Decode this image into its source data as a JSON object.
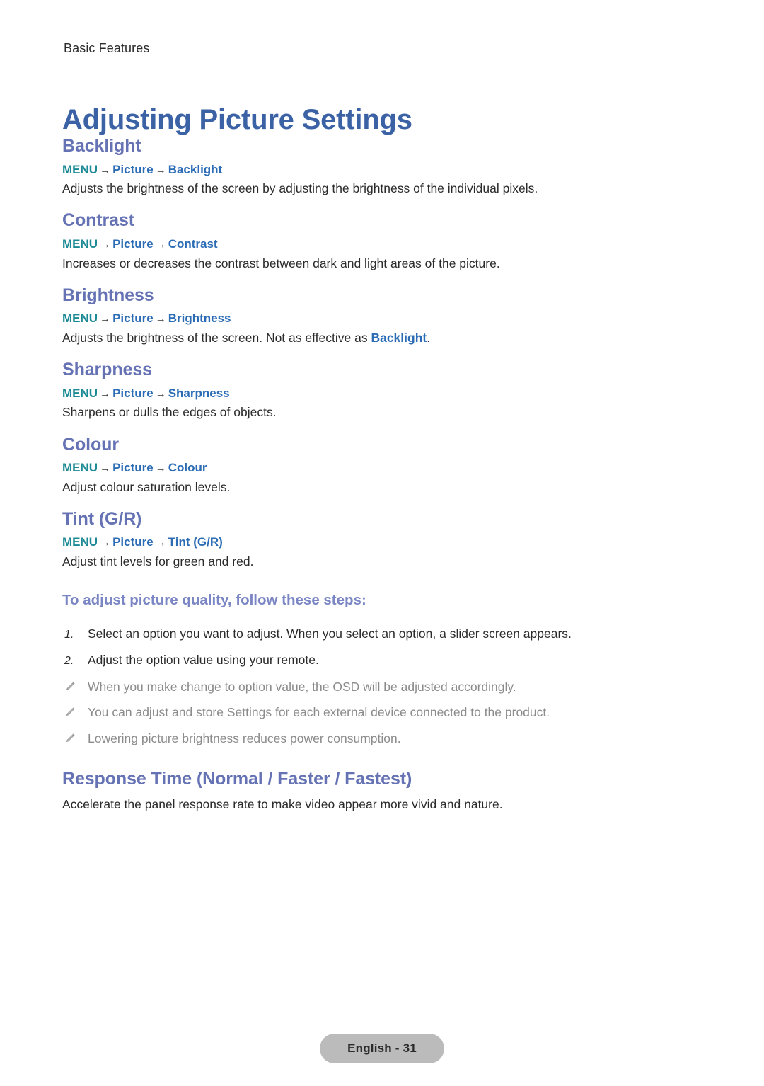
{
  "header": {
    "running_header": "Basic Features",
    "title": "Adjusting Picture Settings"
  },
  "colors": {
    "title": "#3c62a6",
    "section_heading": "#6572b4",
    "menu_root": "#1b8a95",
    "menu_node": "#2b6cb5",
    "body_text": "#2b2b2b",
    "note_text": "#8b8b8b",
    "footer_pill": "#bbbbbb"
  },
  "sections": [
    {
      "heading": "Backlight",
      "menu_root": "MENU",
      "arrow": "→",
      "menu_mid": "Picture",
      "menu_leaf": "Backlight",
      "description": "Adjusts the brightness of the screen by adjusting the brightness of the individual pixels."
    },
    {
      "heading": "Contrast",
      "menu_root": "MENU",
      "arrow": "→",
      "menu_mid": "Picture",
      "menu_leaf": "Contrast",
      "description": "Increases or decreases the contrast between dark and light areas of the picture."
    },
    {
      "heading": "Brightness",
      "menu_root": "MENU",
      "arrow": "→",
      "menu_mid": "Picture",
      "menu_leaf": "Brightness",
      "description_before": "Adjusts the brightness of the screen. Not as effective as ",
      "description_link": "Backlight",
      "description_after": "."
    },
    {
      "heading": "Sharpness",
      "menu_root": "MENU",
      "arrow": "→",
      "menu_mid": "Picture",
      "menu_leaf": "Sharpness",
      "description": "Sharpens or dulls the edges of objects."
    },
    {
      "heading": "Colour",
      "menu_root": "MENU",
      "arrow": "→",
      "menu_mid": "Picture",
      "menu_leaf": "Colour",
      "description": "Adjust colour saturation levels."
    },
    {
      "heading": "Tint (G/R)",
      "menu_root": "MENU",
      "arrow": "→",
      "menu_mid": "Picture",
      "menu_leaf": "Tint (G/R)",
      "description": "Adjust tint levels for green and red."
    }
  ],
  "steps_block": {
    "heading": "To adjust picture quality, follow these steps:",
    "steps": [
      {
        "number": "1.",
        "text": "Select an option you want to adjust. When you select an option, a slider screen appears."
      },
      {
        "number": "2.",
        "text": "Adjust the option value using your remote."
      }
    ],
    "notes": [
      "When you make change to option value, the OSD will be adjusted accordingly.",
      "You can adjust and store Settings for each external device connected to the product.",
      "Lowering picture brightness reduces power consumption."
    ],
    "note_icon": "pencil-icon"
  },
  "response_block": {
    "heading": "Response Time (Normal / Faster / Fastest)",
    "description": "Accelerate the panel response rate to make video appear more vivid and nature."
  },
  "footer": {
    "label": "English - 31"
  }
}
